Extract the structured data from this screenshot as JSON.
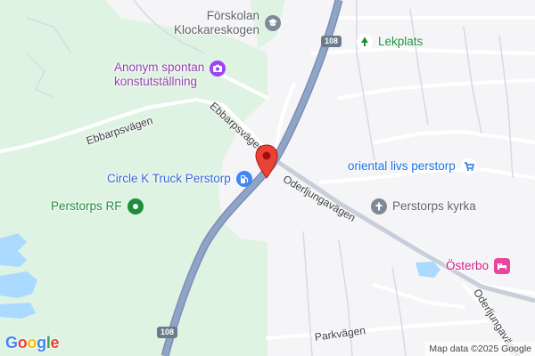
{
  "map": {
    "colors": {
      "land": "#f5f4f6",
      "green": "#dff3e3",
      "green_dark": "#cdebd5",
      "water": "#aadaff",
      "road_major": "#8fa4c7",
      "road_major_outline": "#7b8fb5",
      "road_minor": "#ffffff",
      "road_secondary": "#d6dbe4",
      "pin": "#ea4335"
    },
    "pois": [
      {
        "name": "Förskolan\nKlockareskogen",
        "icon": "school-icon",
        "color": "#5f6368",
        "icon_bg": "#ffffff"
      },
      {
        "name": "Anonym spontan\nkonstutställning",
        "icon": "camera-icon",
        "color": "#8e44ad",
        "icon_bg": "#a142f4"
      },
      {
        "name": "Lekplats",
        "icon": "tree-icon",
        "color": "#1e8e3e",
        "icon_bg": "#ffffff"
      },
      {
        "name": "Circle K Truck Perstorp",
        "icon": "fuel-icon",
        "color": "#3367d6",
        "icon_bg": "#4285f4"
      },
      {
        "name": "oriental livs perstorp",
        "icon": "cart-icon",
        "color": "#1a73e8",
        "icon_bg": "#ffffff"
      },
      {
        "name": "Perstorps RF",
        "icon": "park-icon",
        "color": "#1e8e3e",
        "icon_bg": "#1e8e3e"
      },
      {
        "name": "Perstorps kyrka",
        "icon": "cross-icon",
        "color": "#5f6368",
        "icon_bg": "#7d8a99"
      },
      {
        "name": "Österbo",
        "icon": "bed-icon",
        "color": "#d01884",
        "icon_bg": "#e8459e"
      }
    ],
    "streets": [
      "Ebbarpsvägen",
      "Ebbarpsvägen",
      "Oderljungavägen",
      "Oderljungavägen",
      "Parkvägen"
    ],
    "route_shields": [
      "108",
      "108"
    ],
    "google_logo": {
      "letters": [
        "G",
        "o",
        "o",
        "g",
        "l",
        "e"
      ],
      "colors": [
        "#4285f4",
        "#ea4335",
        "#fbbc05",
        "#4285f4",
        "#34a853",
        "#ea4335"
      ]
    },
    "attribution": "Map data ©2025 Google"
  }
}
